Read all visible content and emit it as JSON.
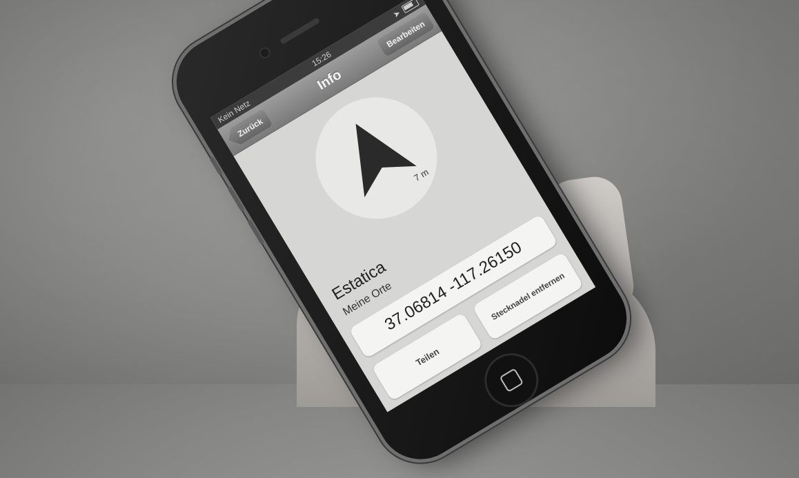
{
  "status_bar": {
    "carrier": "Kein Netz",
    "time": "15:26"
  },
  "nav": {
    "back_label": "Zurück",
    "title": "Info",
    "edit_label": "Bearbeiten"
  },
  "compass": {
    "icon": "navigation-arrow-icon",
    "distance": "7 m"
  },
  "location": {
    "name": "Estatica",
    "collection": "Meine Orte",
    "coordinates": "37.06814 -117.26150"
  },
  "actions": {
    "share_label": "Teilen",
    "remove_pin_label": "Stecknadel entfernen"
  }
}
